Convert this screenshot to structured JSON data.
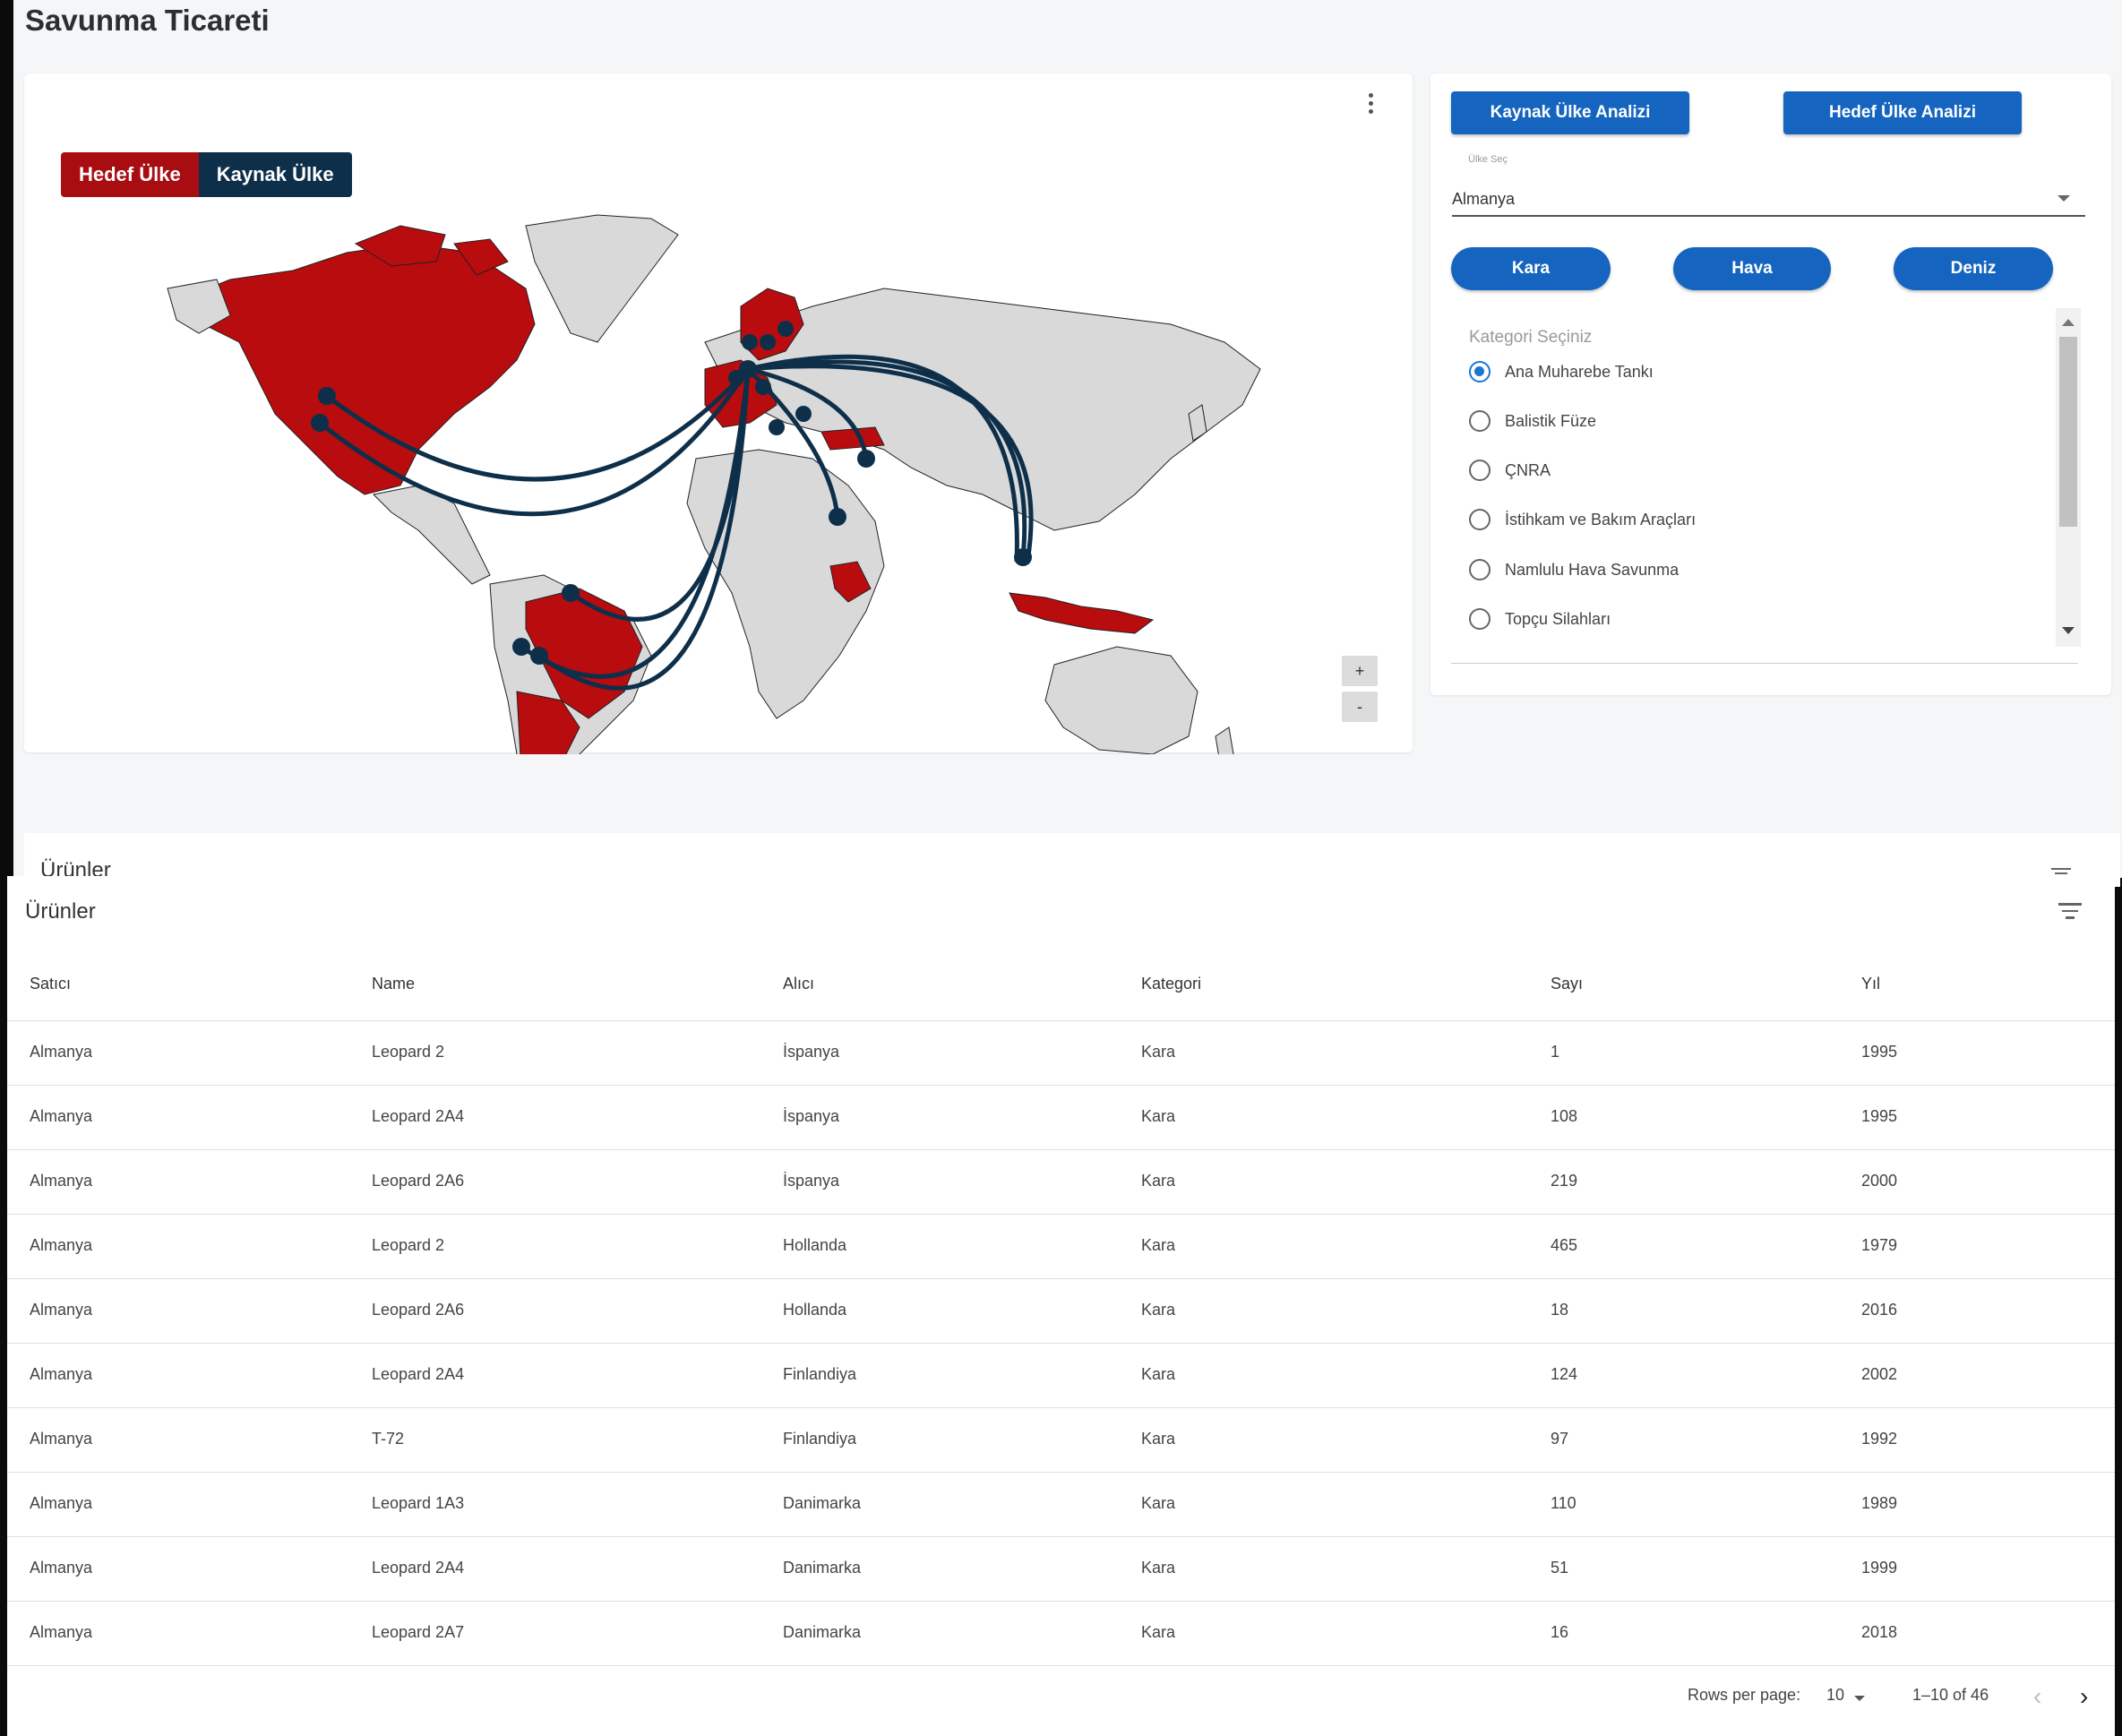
{
  "page": {
    "title": "Savunma Ticareti"
  },
  "map": {
    "legend": {
      "target": "Hedef Ülke",
      "source": "Kaynak Ülke"
    },
    "colors": {
      "target": "#a80d12",
      "source": "#0e2f4a",
      "land": "#d9d9d9"
    },
    "zoom_in": "+",
    "zoom_out": "-",
    "menu_icon": "more-vert-icon"
  },
  "controls": {
    "source_analysis": "Kaynak Ülke Analizi",
    "target_analysis": "Hedef Ülke Analizi",
    "country_select": {
      "label": "Ülke Seç",
      "value": "Almanya"
    },
    "domains": [
      "Kara",
      "Hava",
      "Deniz"
    ],
    "category_title": "Kategori Seçiniz",
    "categories": [
      {
        "label": "Ana Muharebe Tankı",
        "checked": true
      },
      {
        "label": "Balistik Füze",
        "checked": false
      },
      {
        "label": "ÇNRA",
        "checked": false
      },
      {
        "label": "İstihkam ve Bakım Araçları",
        "checked": false
      },
      {
        "label": "Namlulu Hava Savunma",
        "checked": false
      },
      {
        "label": "Topçu Silahları",
        "checked": false
      }
    ]
  },
  "products": {
    "title": "Ürünler",
    "columns": [
      "Satıcı",
      "Name",
      "Alıcı",
      "Kategori",
      "Sayı",
      "Yıl"
    ],
    "rows": [
      [
        "Almanya",
        "Leopard 2",
        "İspanya",
        "Kara",
        "1",
        "1995"
      ],
      [
        "Almanya",
        "Leopard 2A4",
        "İspanya",
        "Kara",
        "108",
        "1995"
      ],
      [
        "Almanya",
        "Leopard 2A6",
        "İspanya",
        "Kara",
        "219",
        "2000"
      ],
      [
        "Almanya",
        "Leopard 2",
        "Hollanda",
        "Kara",
        "465",
        "1979"
      ],
      [
        "Almanya",
        "Leopard 2A6",
        "Hollanda",
        "Kara",
        "18",
        "2016"
      ],
      [
        "Almanya",
        "Leopard 2A4",
        "Finlandiya",
        "Kara",
        "124",
        "2002"
      ],
      [
        "Almanya",
        "T-72",
        "Finlandiya",
        "Kara",
        "97",
        "1992"
      ],
      [
        "Almanya",
        "Leopard 1A3",
        "Danimarka",
        "Kara",
        "110",
        "1989"
      ],
      [
        "Almanya",
        "Leopard 2A4",
        "Danimarka",
        "Kara",
        "51",
        "1999"
      ],
      [
        "Almanya",
        "Leopard 2A7",
        "Danimarka",
        "Kara",
        "16",
        "2018"
      ]
    ],
    "pagination": {
      "rows_per_page_label": "Rows per page:",
      "rows_per_page": "10",
      "range": "1–10 of 46"
    }
  }
}
